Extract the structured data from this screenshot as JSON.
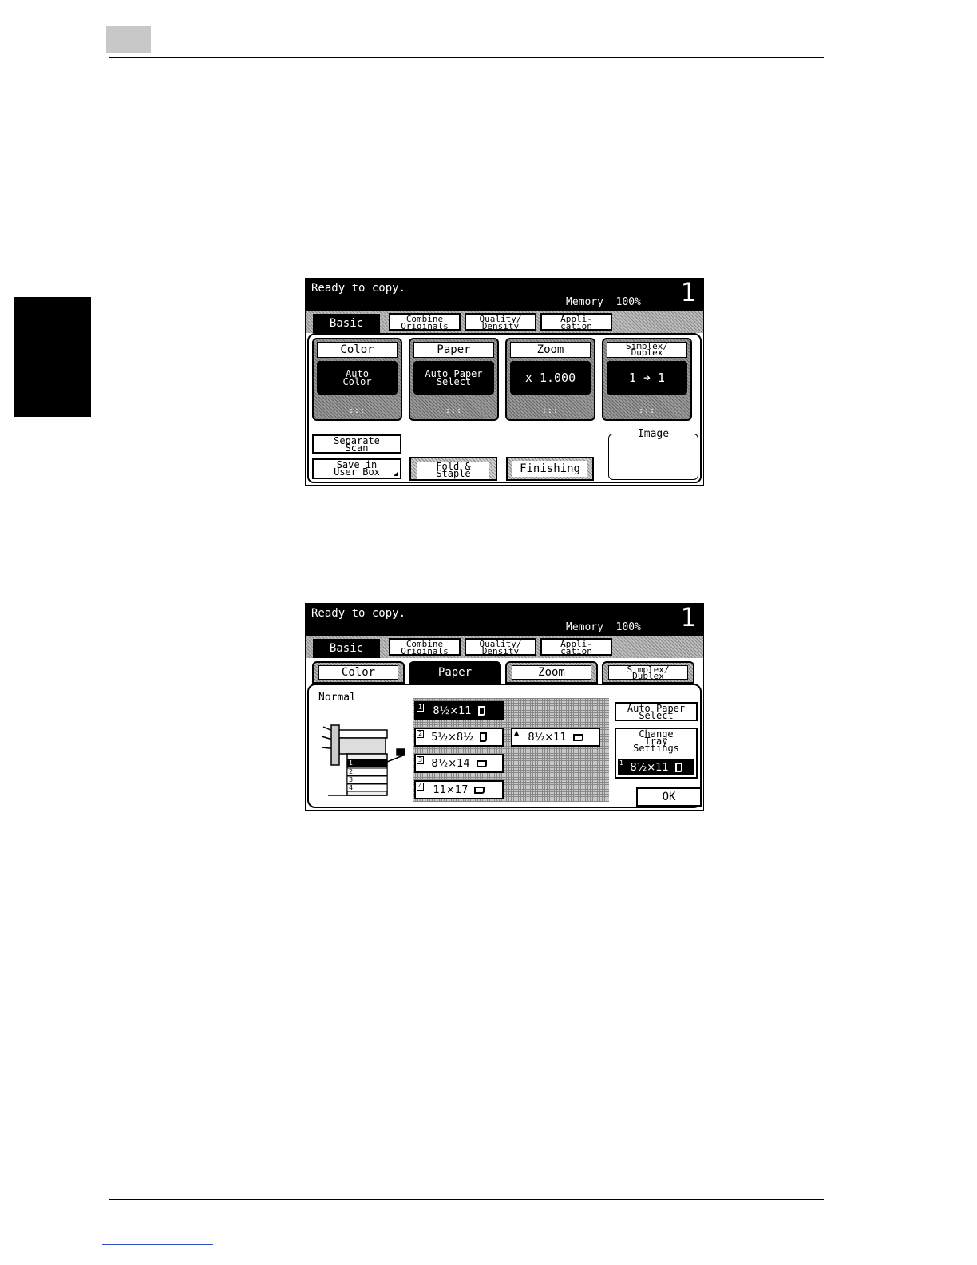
{
  "screen": {
    "status": "Ready to copy.",
    "memory_label": "Memory",
    "memory_value": "100%",
    "copy_count": "1"
  },
  "main_tabs": [
    {
      "line1": "Basic",
      "line2": ""
    },
    {
      "line1": "Combine",
      "line2": "Originals"
    },
    {
      "line1": "Quality/",
      "line2": "Density"
    },
    {
      "line1": "Appli-",
      "line2": "cation"
    }
  ],
  "basic_functions": [
    {
      "label1": "Color",
      "label2": "",
      "value1": "Auto",
      "value2": "Color"
    },
    {
      "label1": "Paper",
      "label2": "",
      "value1": "Auto Paper",
      "value2": "Select"
    },
    {
      "label1": "Zoom",
      "label2": "",
      "value1": "x 1.000",
      "value2": ""
    },
    {
      "label1": "Simplex/",
      "label2": "Duplex",
      "value1": "1 ➔ 1",
      "value2": ""
    }
  ],
  "dots": ":::",
  "basic_buttons": {
    "separate_scan": [
      "Separate",
      "Scan"
    ],
    "save_user_box": [
      "Save in",
      "User Box"
    ],
    "fold_staple": [
      "Fold &",
      "Staple"
    ],
    "finishing": "Finishing",
    "image": "Image"
  },
  "paper_screen": {
    "sub_tabs": [
      {
        "line1": "Color",
        "line2": ""
      },
      {
        "line1": "Paper",
        "line2": ""
      },
      {
        "line1": "Zoom",
        "line2": ""
      },
      {
        "line1": "Simplex/",
        "line2": "Duplex"
      }
    ],
    "section": "Normal",
    "trays": [
      {
        "num": "1",
        "size": "8½×11"
      },
      {
        "num": "2",
        "size": "5½×8½"
      },
      {
        "num": "3",
        "size": "8½×14"
      },
      {
        "num": "4",
        "size": "11×17"
      },
      {
        "num": "▲",
        "size": "8½×11"
      }
    ],
    "machine_tray_numbers": [
      "1",
      "2",
      "3",
      "4"
    ],
    "auto_paper_select": [
      "Auto Paper",
      "Select"
    ],
    "change_tray_settings": [
      "Change",
      "Tray",
      "Settings"
    ],
    "current_tray": {
      "num": "1",
      "size": "8½×11"
    },
    "ok": "OK"
  }
}
